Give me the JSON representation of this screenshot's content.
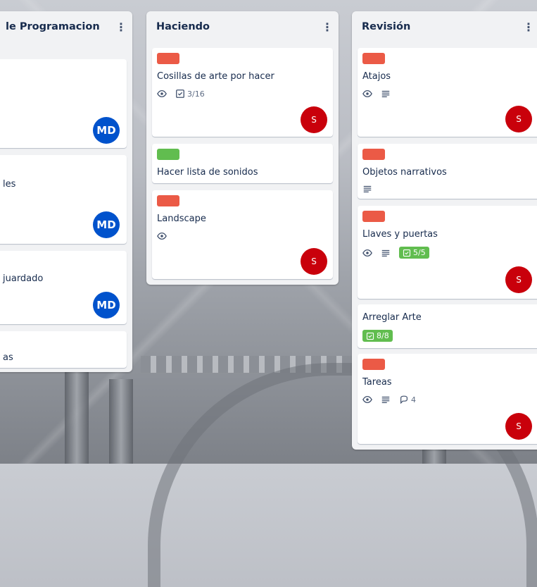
{
  "colors": {
    "red_label": "#eb5a46",
    "green_label": "#61bd4f",
    "avatar_md": "#0052cc",
    "avatar_s": "#c9000b"
  },
  "columns": [
    {
      "title": "le Programacion",
      "cards": [
        {
          "title": "",
          "avatar": "MD"
        },
        {
          "title": "les",
          "avatar": "MD"
        },
        {
          "title": "juardado",
          "avatar": "MD"
        },
        {
          "title": "as"
        }
      ]
    },
    {
      "title": "Haciendo",
      "cards": [
        {
          "label": "red",
          "title": "Cosillas de arte por hacer",
          "checklist": "3/16",
          "avatar": "S"
        },
        {
          "label": "green",
          "title": "Hacer lista de sonidos"
        },
        {
          "label": "red",
          "title": "Landscape",
          "avatar": "S"
        }
      ]
    },
    {
      "title": "Revisión",
      "cards": [
        {
          "label": "red",
          "title": "Atajos",
          "avatar": "S"
        },
        {
          "label": "red",
          "title": "Objetos narrativos"
        },
        {
          "label": "red",
          "title": "Llaves y puertas",
          "checklist": "5/5",
          "avatar": "S"
        },
        {
          "title": "Arreglar Arte",
          "checklist": "8/8"
        },
        {
          "label": "red",
          "title": "Tareas",
          "comments": "4",
          "avatar": "S"
        }
      ]
    }
  ],
  "icons": [
    "eye-icon",
    "description-icon",
    "checklist-icon",
    "comment-icon",
    "more-vertical-icon"
  ]
}
